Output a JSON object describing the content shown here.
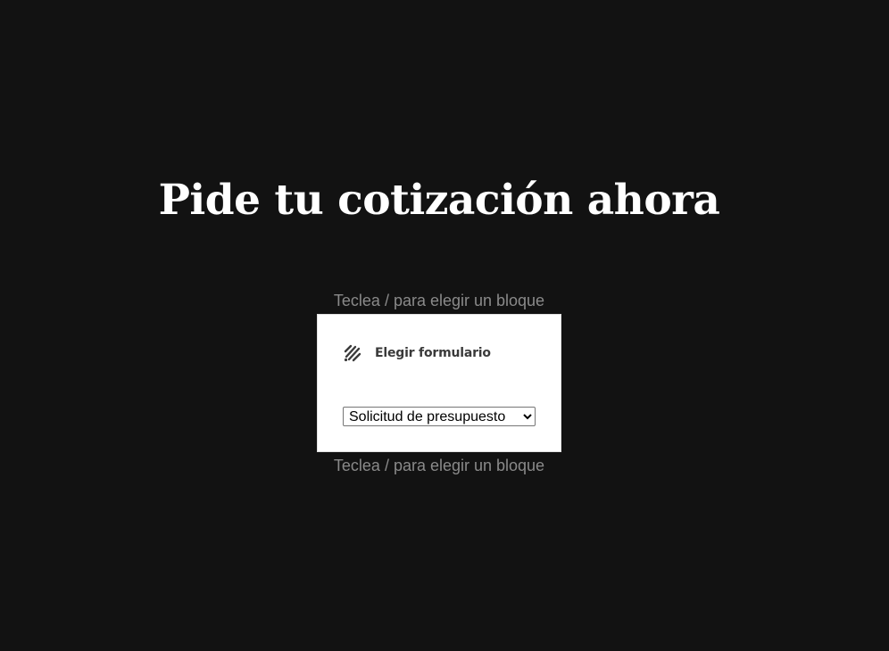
{
  "page": {
    "heading": "Pide tu cotización ahora"
  },
  "block_placeholder": {
    "top": "Teclea / para elegir un bloque",
    "bottom": "Teclea / para elegir un bloque"
  },
  "form_block": {
    "icon": "form-block-icon",
    "title": "Elegir formulario",
    "select": {
      "selected": "Solicitud de presupuesto",
      "options": [
        "Solicitud de presupuesto"
      ]
    }
  },
  "colors": {
    "background": "#121212",
    "heading_text": "#ffffff",
    "placeholder_text": "#8a8a8a",
    "block_background": "#ffffff",
    "block_title": "#3a3a3a"
  }
}
